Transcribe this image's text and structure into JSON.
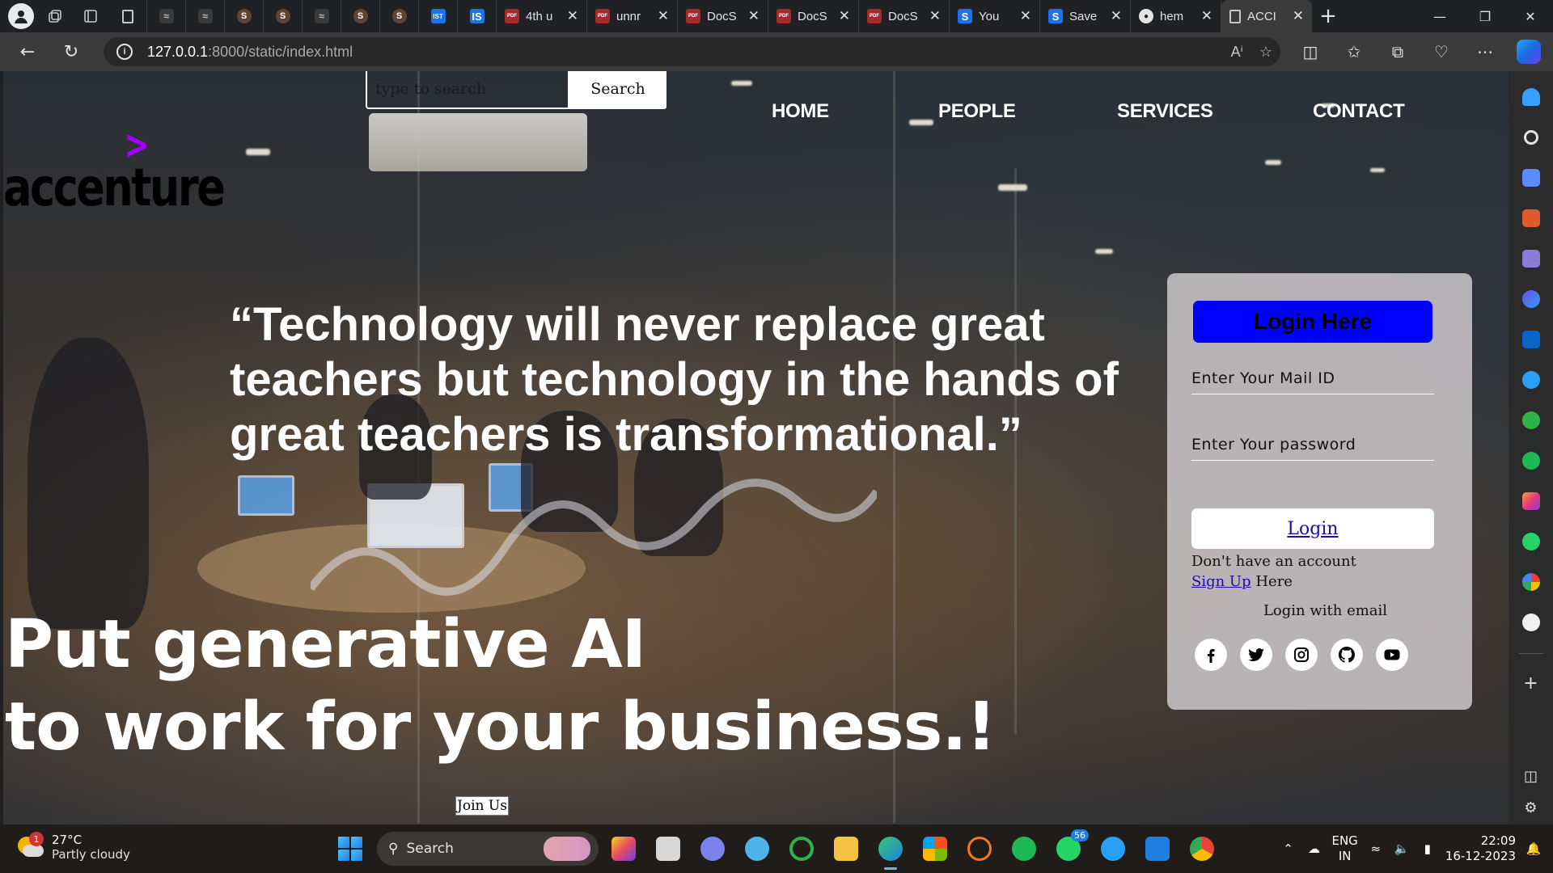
{
  "browser": {
    "tabs": [
      {
        "title": "",
        "favicon": "page-icon",
        "kind": "mini"
      },
      {
        "title": "",
        "favicon": "mv-icon",
        "kind": "mini"
      },
      {
        "title": "",
        "favicon": "mv-icon",
        "kind": "mini"
      },
      {
        "title": "",
        "favicon": "ms-icon",
        "kind": "mini"
      },
      {
        "title": "",
        "favicon": "ms-icon",
        "kind": "mini"
      },
      {
        "title": "",
        "favicon": "mv-icon",
        "kind": "mini"
      },
      {
        "title": "",
        "favicon": "ms-icon",
        "kind": "mini"
      },
      {
        "title": "",
        "favicon": "ms-icon",
        "kind": "mini"
      },
      {
        "title": "",
        "favicon": "ist-icon",
        "kind": "mini"
      },
      {
        "title": "",
        "favicon": "is-icon",
        "kind": "mini"
      },
      {
        "title": "4th u",
        "favicon": "pdf-icon",
        "kind": "wide"
      },
      {
        "title": "unnr",
        "favicon": "pdf-icon",
        "kind": "wide"
      },
      {
        "title": "DocS",
        "favicon": "pdf-icon",
        "kind": "wide"
      },
      {
        "title": "DocS",
        "favicon": "pdf-icon",
        "kind": "wide"
      },
      {
        "title": "DocS",
        "favicon": "pdf-icon",
        "kind": "wide"
      },
      {
        "title": "You",
        "favicon": "s-icon",
        "kind": "wide"
      },
      {
        "title": "Save",
        "favicon": "s-icon",
        "kind": "wide"
      },
      {
        "title": "hem",
        "favicon": "github-icon",
        "kind": "wide"
      },
      {
        "title": "ACCI",
        "favicon": "page-icon",
        "kind": "active"
      }
    ],
    "url_host": "127.0.0.1",
    "url_path": ":8000/static/index.html"
  },
  "page": {
    "search": {
      "placeholder": "type to search",
      "button_label": "Search"
    },
    "logo": {
      "text": "accenture",
      "mark": ">"
    },
    "nav": [
      {
        "label": "HOME"
      },
      {
        "label": "PEOPLE"
      },
      {
        "label": "SERVICES"
      },
      {
        "label": "CONTACT"
      }
    ],
    "quote": "“Technology will never replace great teachers but technology in the hands of great teachers is transformational.”",
    "hero_line1": "Put generative AI",
    "hero_line2": "to work for your business.!",
    "join_label": "Join Us",
    "login": {
      "title": "Login Here",
      "email_placeholder": "Enter Your Mail ID",
      "password_placeholder": "Enter Your password",
      "button_label": "Login",
      "no_account_text": "Don't have an account",
      "signup_link": "Sign Up",
      "signup_suffix": " Here",
      "login_with_text": "Login with email",
      "socials": [
        "facebook-icon",
        "twitter-icon",
        "instagram-icon",
        "github-icon",
        "youtube-icon"
      ]
    }
  },
  "taskbar": {
    "weather_temp": "27°C",
    "weather_desc": "Partly cloudy",
    "weather_badge": "1",
    "search_label": "Search",
    "whatsapp_badge": "56",
    "lang_line1": "ENG",
    "lang_line2": "IN",
    "time": "22:09",
    "date": "16-12-2023"
  },
  "colors": {
    "login_title_bg": "#0000ff",
    "logo_mark": "#a100ff",
    "accent_blue": "#4cc2ff"
  }
}
